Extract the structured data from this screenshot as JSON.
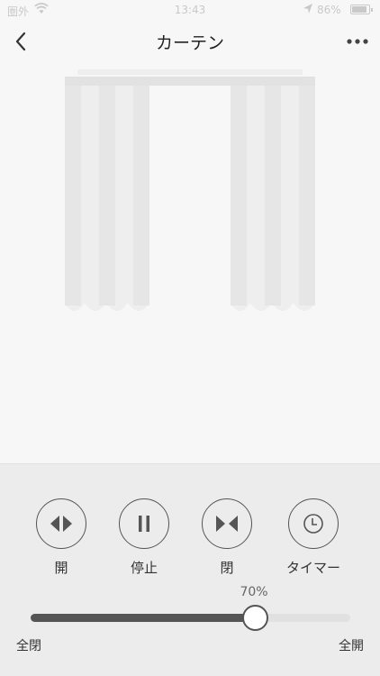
{
  "status_bar": {
    "carrier": "圏外",
    "time": "13:43",
    "battery": "86%"
  },
  "nav": {
    "title": "カーテン",
    "back_icon": "chevron-left-icon",
    "more_icon": "more-dots-icon"
  },
  "controls": {
    "open_label": "開",
    "stop_label": "停止",
    "close_label": "閉",
    "timer_label": "タイマー"
  },
  "slider": {
    "value_label": "70%",
    "value": 70,
    "left_label": "全閉",
    "right_label": "全開"
  },
  "colors": {
    "panel_bg": "#ececec",
    "accent": "#555555",
    "curtain": "#e8e8e8"
  }
}
